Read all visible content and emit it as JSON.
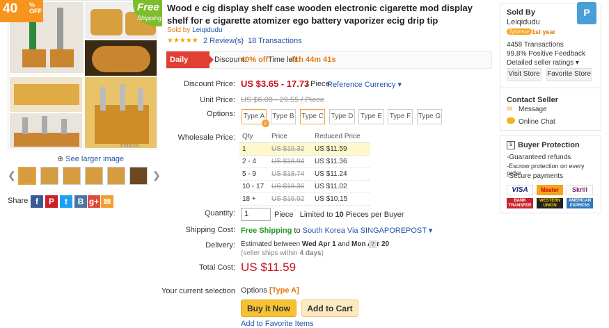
{
  "gallery": {
    "badge_num": "40",
    "badge_pct": "%",
    "badge_off": "OFF",
    "free_l1": "Free",
    "free_l2": "Shipping",
    "larger": "See larger image",
    "watermark": "leiqidudu"
  },
  "share": {
    "label": "Share on",
    "facebook": "f",
    "pinterest": "P",
    "twitter": "t",
    "vk": "B",
    "gplus": "g+"
  },
  "product": {
    "title": "Wood e cig display shelf case wooden electronic cigarette mod display shelf for e cigarette atomizer ego battery vaporizer ecig drip tip",
    "sold_by_prefix": "Sold by",
    "sold_by": "Leiqidudu",
    "stars": "★★★★★",
    "reviews": "2 Review(s)",
    "sep": "|",
    "transactions": "18 Transactions"
  },
  "deals": {
    "tag": "Daily Deals",
    "discount_label": "Discount:",
    "discount": "40% off",
    "time_label": "Time left:",
    "time": "41h 44m 41s"
  },
  "labels": {
    "discount_price": "Discount Price:",
    "unit_price": "Unit Price:",
    "options": "Options:",
    "wholesale": "Wholesale Price:",
    "quantity": "Quantity:",
    "shipping": "Shipping Cost:",
    "delivery": "Delivery:",
    "total": "Total Cost:",
    "your_sel": "Your current selection"
  },
  "price": {
    "range": "US $3.65 - 17.73",
    "per": "/ Piece",
    "ref": "Reference Currency ▾",
    "unit": "US $6.08 - 29.55 / Piece"
  },
  "options": [
    "Type A",
    "Type B",
    "Type C",
    "Type D",
    "Type E",
    "Type F",
    "Type G"
  ],
  "wholesale": {
    "headers": [
      "Qty",
      "Price",
      "Reduced Price"
    ],
    "rows": [
      {
        "qty": "1",
        "price": "US $19.32",
        "reduced": "US $11.59"
      },
      {
        "qty": "2 - 4",
        "price": "US $18.94",
        "reduced": "US $11.36"
      },
      {
        "qty": "5 - 9",
        "price": "US $18.74",
        "reduced": "US $11.24"
      },
      {
        "qty": "10 - 17",
        "price": "US $18.36",
        "reduced": "US $11.02"
      },
      {
        "qty": "18 +",
        "price": "US $16.92",
        "reduced": "US $10.15"
      }
    ]
  },
  "quantity": {
    "value": "1",
    "unit": "Piece",
    "limit_pre": "Limited to",
    "limit_num": "10",
    "limit_post": "Pieces per Buyer"
  },
  "shipping": {
    "free": "Free Shipping",
    "to": "to",
    "dest": "South Korea Via SINGAPOREPOST ▾"
  },
  "delivery": {
    "pre": "Estimated between",
    "d1": "Wed Apr 1",
    "and": "and",
    "d2": "Mon Apr 20",
    "q": "?",
    "within_pre": "(seller ships within",
    "within_days": "4 days",
    "within_post": ")"
  },
  "total": "US $11.59",
  "selection": {
    "prefix": "Options",
    "value": "[Type A]"
  },
  "buttons": {
    "buy": "Buy it Now",
    "cart": "Add to Cart",
    "fav": "Add to Favorite Items"
  },
  "seller": {
    "heading": "Sold By",
    "name": "Leiqidudu",
    "sponsor": "Sponsor",
    "year": "1st year",
    "transactions": "4458 Transactions",
    "feedback": "99.8% Positive Feedback",
    "ratings": "Detailed seller ratings ▾",
    "visit": "Visit Store",
    "favorite": "Favorite Store"
  },
  "contact": {
    "heading": "Contact Seller",
    "message": "Message",
    "chat": "Online Chat"
  },
  "protection": {
    "heading": "Buyer Protection",
    "items": [
      "-Guaranteed refunds",
      "-Escrow protection on every order",
      "-Secure payments"
    ],
    "payments": [
      "VISA",
      "Master",
      "Skrill",
      "BANK TRANSFER",
      "WESTERN UNION",
      "AMERICAN EXPRESS"
    ]
  },
  "colors": {
    "accent": "#c6111b",
    "orange": "#f1a23a",
    "link": "#2255aa"
  }
}
